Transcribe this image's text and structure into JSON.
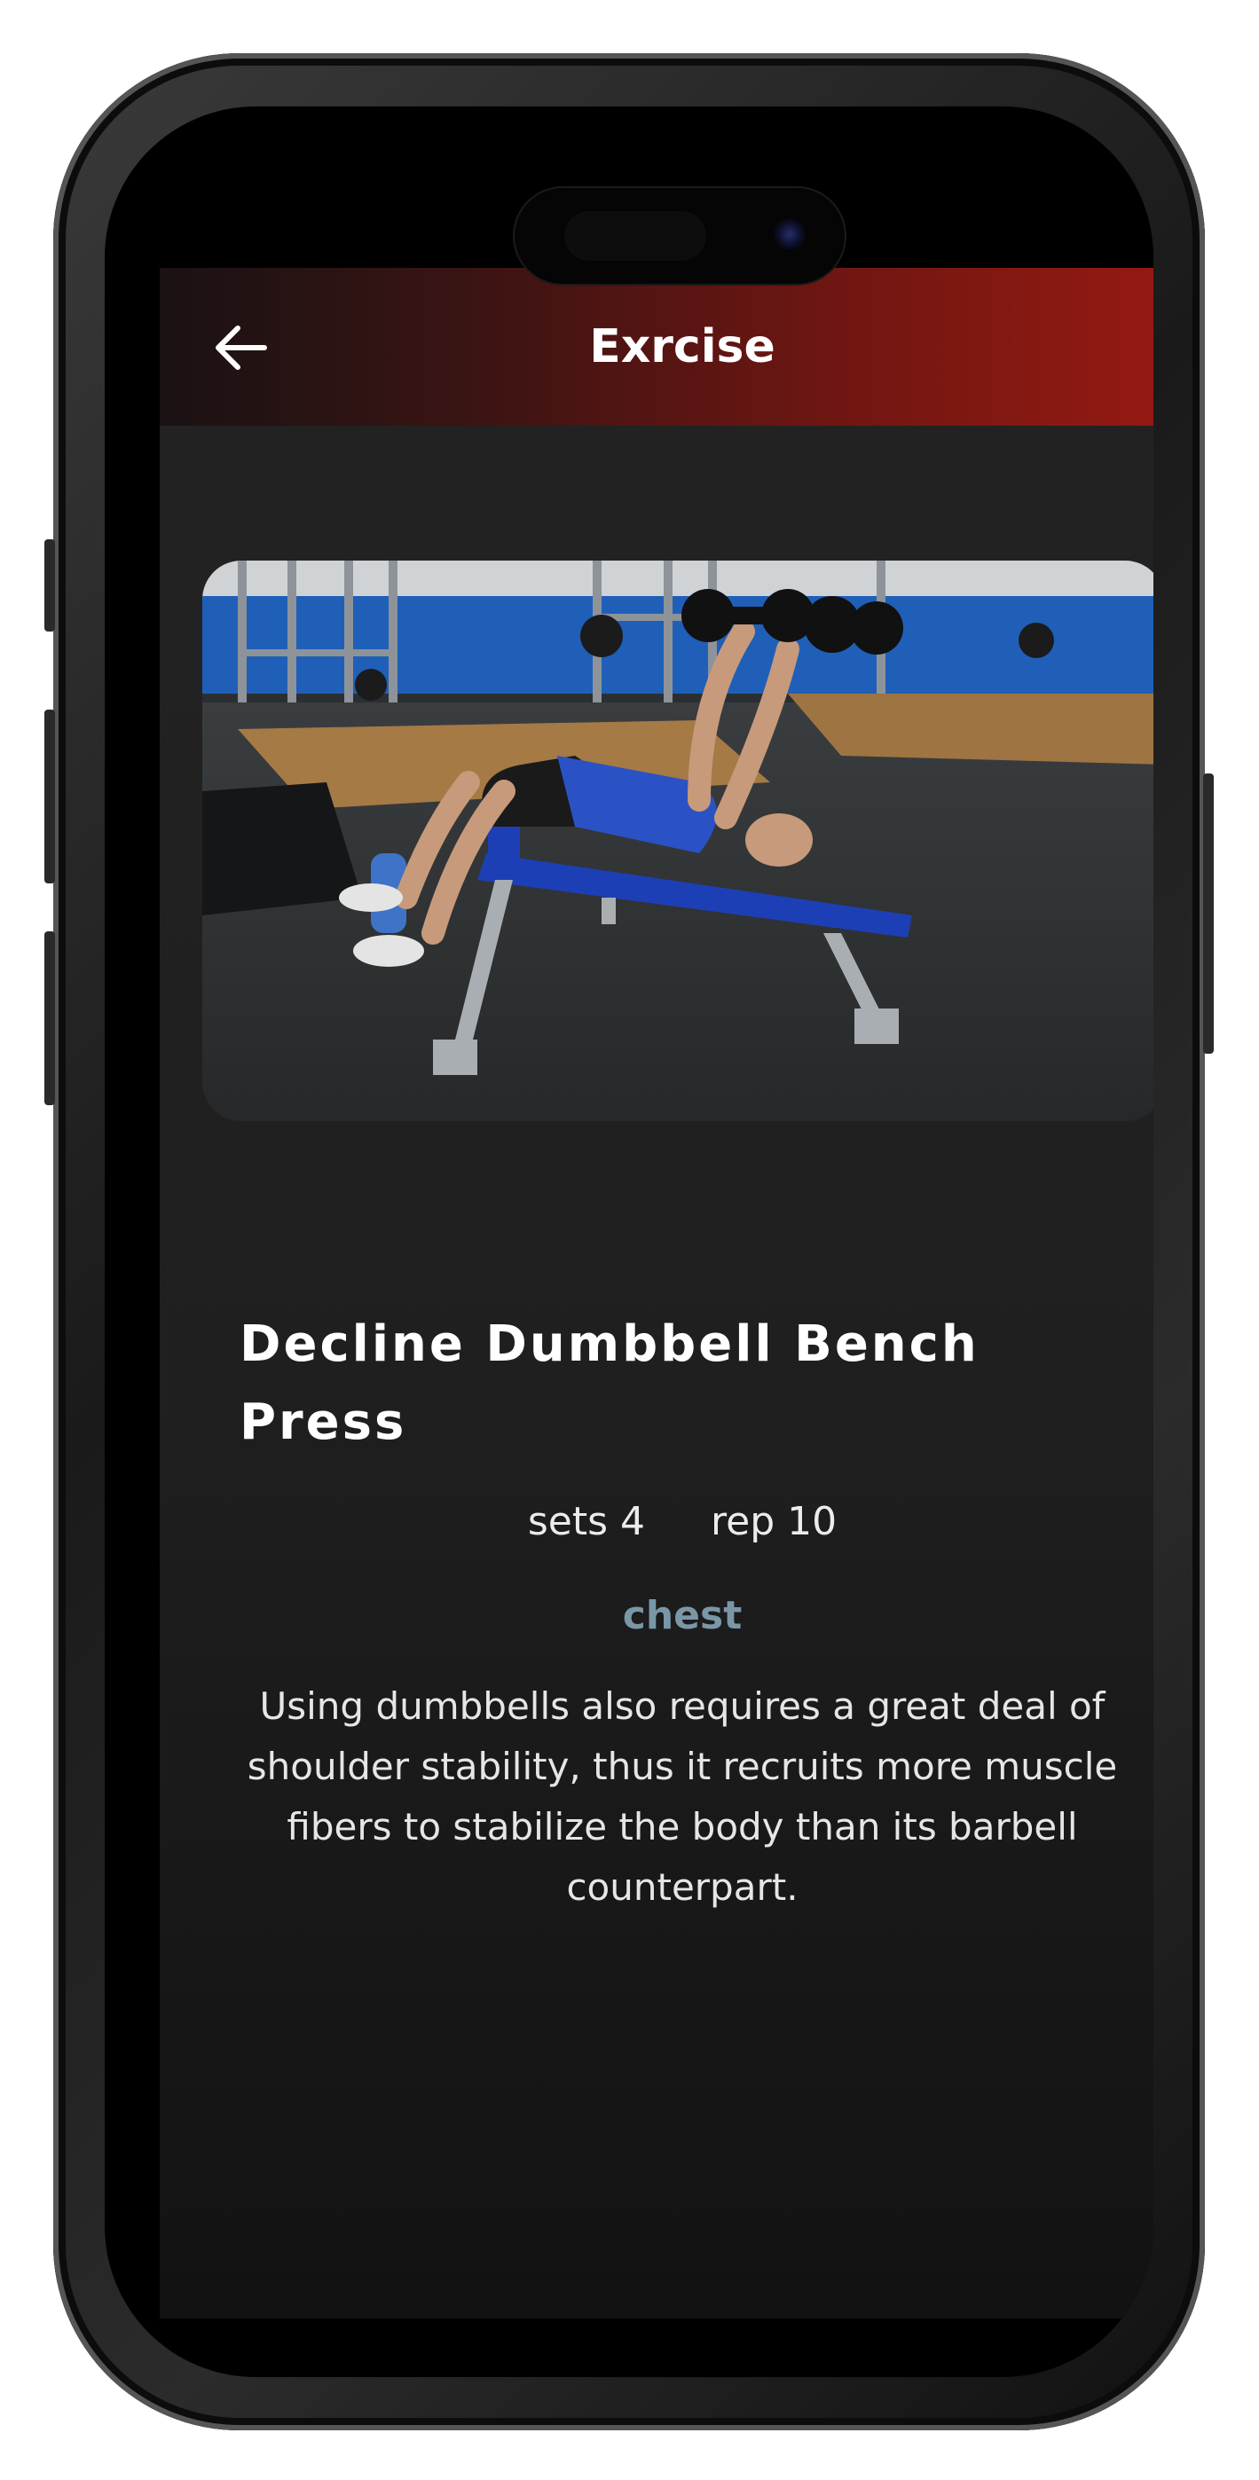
{
  "header": {
    "title": "Exrcise",
    "back_icon": "arrow-left-icon"
  },
  "exercise": {
    "image_alt": "decline dumbbell bench press demonstration",
    "name": "Decline Dumbbell Bench Press",
    "sets_text": "sets 4",
    "reps_text": "rep 10",
    "muscle": "chest",
    "description": "Using dumbbells also requires a great deal of shoulder stability, thus it recruits more muscle fibers to stabilize the body than its barbell counterpart."
  },
  "colors": {
    "header_start": "#1a1213",
    "header_end": "#991a12",
    "background": "#1f1f1f",
    "muscle_accent": "#7a97a8"
  }
}
